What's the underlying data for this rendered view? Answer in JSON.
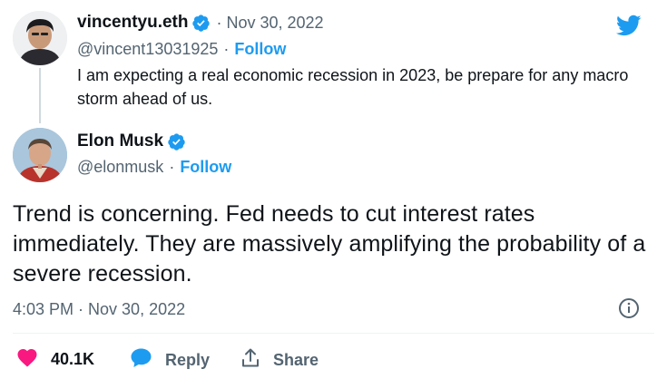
{
  "colors": {
    "accent": "#1d9bf0",
    "verified": "#1d9bf0",
    "like": "#f91880",
    "text_secondary": "#536471"
  },
  "quoted_tweet": {
    "display_name": "vincentyu.eth",
    "date": "· Nov 30, 2022",
    "handle": "@vincent13031925",
    "handle_separator": "·",
    "follow_label": "Follow",
    "text": "I am expecting a real economic recession in 2023, be prepare for any macro storm ahead of us."
  },
  "main_tweet": {
    "display_name": "Elon Musk",
    "handle": "@elonmusk",
    "handle_separator": "·",
    "follow_label": "Follow",
    "text": "Trend is concerning. Fed needs to cut interest rates immediately. They are massively amplifying the probability of a severe recession.",
    "timestamp": "4:03 PM · Nov 30, 2022"
  },
  "actions": {
    "like_count": "40.1K",
    "reply_label": "Reply",
    "share_label": "Share"
  },
  "icons": {
    "logo": "twitter-bird-icon",
    "verified": "verified-badge-icon",
    "info": "info-icon",
    "like": "heart-icon",
    "reply": "reply-bubble-icon",
    "share": "share-icon"
  }
}
